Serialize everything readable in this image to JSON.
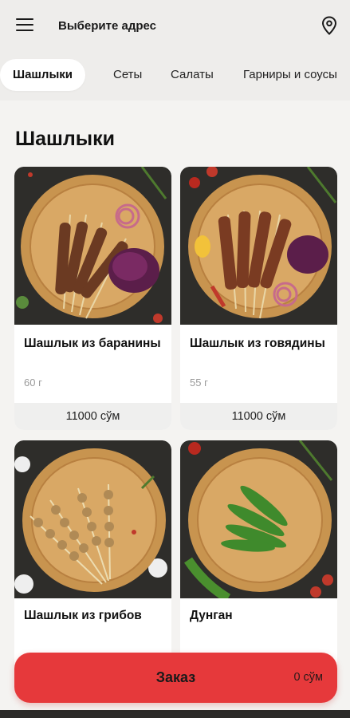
{
  "header": {
    "address_label": "Выберите адрес",
    "menu_icon": "hamburger-menu-icon",
    "location_icon": "map-pin-icon"
  },
  "tabs": [
    {
      "label": "Шашлыки",
      "active": true
    },
    {
      "label": "Сеты",
      "active": false
    },
    {
      "label": "Салаты",
      "active": false
    },
    {
      "label": "Гарниры и соусы",
      "active": false
    }
  ],
  "section": {
    "title": "Шашлыки"
  },
  "products": [
    {
      "name": "Шашлык из баранины",
      "weight": "60 г",
      "price": "11000 сўм"
    },
    {
      "name": "Шашлык из говядины",
      "weight": "55 г",
      "price": "11000 сўм"
    },
    {
      "name": "Шашлык из грибов"
    },
    {
      "name": "Дунган"
    }
  ],
  "order": {
    "label": "Заказ",
    "total": "0 сўм"
  },
  "colors": {
    "accent": "#e6393b",
    "background": "#f4f3f1",
    "header": "#eeedeb"
  }
}
